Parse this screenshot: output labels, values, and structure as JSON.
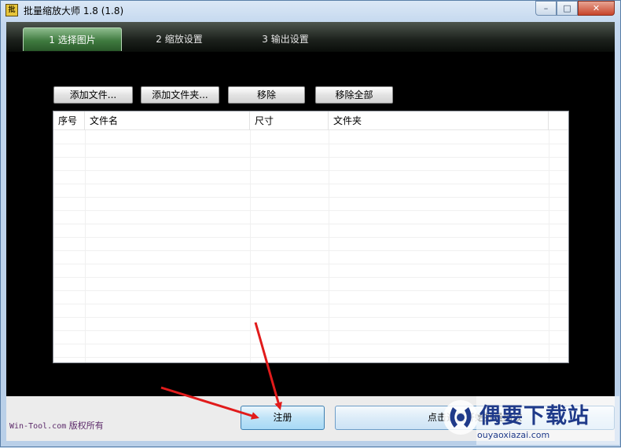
{
  "window": {
    "title": "批量缩放大师 1.8 (1.8)",
    "icon_text": "批",
    "controls": {
      "minimize": "–",
      "maximize": "□",
      "close": "✕"
    }
  },
  "tabs": [
    {
      "label": "1 选择图片",
      "active": true
    },
    {
      "label": "2 缩放设置",
      "active": false
    },
    {
      "label": "3 输出设置",
      "active": false
    }
  ],
  "toolbar": {
    "add_files": "添加文件...",
    "add_folder": "添加文件夹...",
    "remove": "移除",
    "remove_all": "移除全部"
  },
  "file_list": {
    "columns": [
      "序号",
      "文件名",
      "尺寸",
      "文件夹"
    ],
    "rows": []
  },
  "footer": {
    "credit_site": "Win-Tool.com",
    "credit_text": "版权所有",
    "register_button": "注册",
    "start_button": "点击这里开始批量缩放"
  },
  "watermark": {
    "brand": "偶要下载站",
    "url": "ouyaoxiazai.com"
  },
  "colors": {
    "client_background": "#000000",
    "active_tab": "#3f7a3f",
    "annotation_arrow": "#e11b1b",
    "watermark": "#1f3a8a"
  }
}
